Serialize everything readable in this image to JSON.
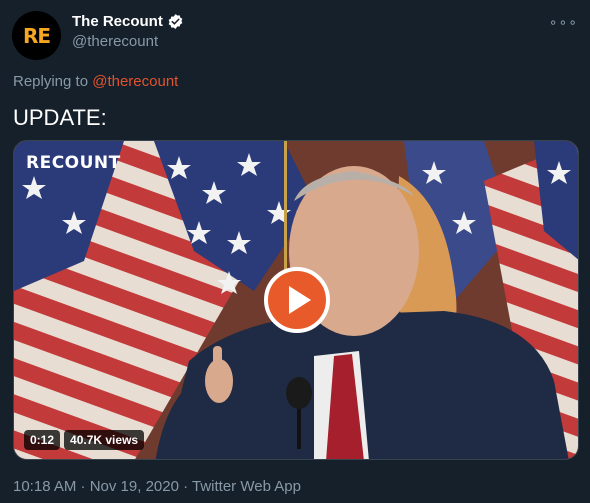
{
  "author": {
    "avatar_text": "RE",
    "display_name": "The Recount",
    "handle": "@therecount",
    "verified": true
  },
  "more_menu": {
    "icon": "more-icon",
    "glyph": "∘∘∘"
  },
  "reply": {
    "prefix": "Replying to",
    "mention": "@therecount"
  },
  "tweet": {
    "text": "UPDATE:"
  },
  "video": {
    "watermark": "RECOUNT",
    "duration": "0:12",
    "views": "40.7K views",
    "play_icon": "play-icon",
    "play_color": "#e85a2a"
  },
  "footer": {
    "meta": "10:18 AM · Nov 19, 2020 · Twitter Web App"
  },
  "colors": {
    "background": "#15202b",
    "secondary_text": "#8899a6",
    "mention": "#e0532d",
    "avatar_accent": "#f5a623"
  }
}
